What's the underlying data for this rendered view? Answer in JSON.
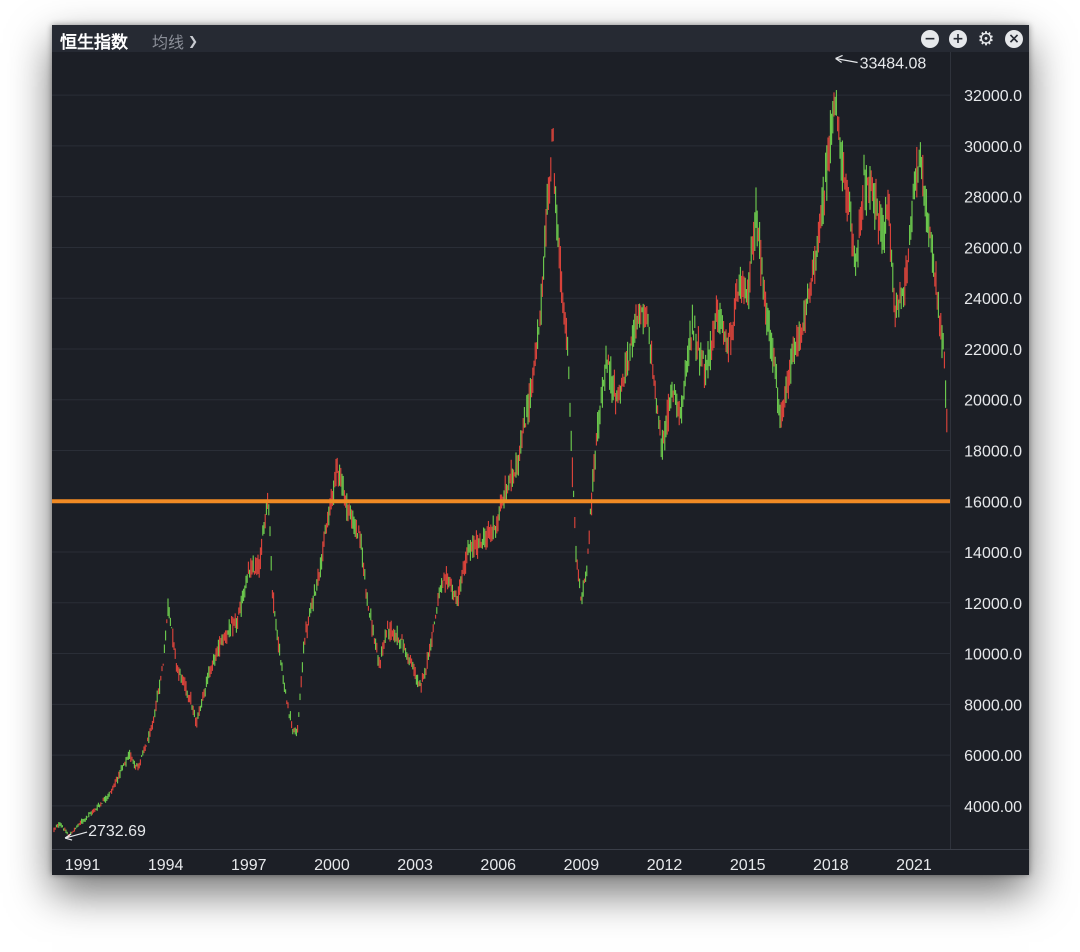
{
  "header": {
    "title": "恒生指数",
    "ma_label": "均线",
    "chevron_icon": "chevron-down-icon",
    "controls": [
      "minus-circle-icon",
      "plus-circle-icon",
      "gear-icon",
      "close-circle-icon"
    ]
  },
  "colors": {
    "background": "#1c1f26",
    "header": "#262a33",
    "up": "#6fd04f",
    "down": "#e2453c",
    "level_line": "#f08a24",
    "axis_text": "#e6e8eb"
  },
  "chart_data": {
    "type": "candlestick",
    "x_ticks": [
      "1991",
      "1994",
      "1997",
      "2000",
      "2003",
      "2006",
      "2009",
      "2012",
      "2015",
      "2018",
      "2021"
    ],
    "y_ticks": [
      "4000.00",
      "6000.00",
      "8000.00",
      "10000.0",
      "12000.0",
      "14000.0",
      "16000.0",
      "18000.0",
      "20000.0",
      "22000.0",
      "24000.0",
      "26000.0",
      "28000.0",
      "30000.0",
      "32000.0"
    ],
    "ylim": [
      2300,
      33700
    ],
    "xlim": [
      1989.9,
      2022.3
    ],
    "horizontal_line": 16000,
    "max_annotation": {
      "label": "33484.08",
      "x": 2018.1,
      "y": 33484.08
    },
    "min_annotation": {
      "label": "2732.69",
      "x": 1990.3,
      "y": 2732.69
    },
    "series_anchors": [
      [
        1989.9,
        3000
      ],
      [
        1990.2,
        3300
      ],
      [
        1990.5,
        2800
      ],
      [
        1990.9,
        3300
      ],
      [
        1991.5,
        3900
      ],
      [
        1992.0,
        4500
      ],
      [
        1992.4,
        5400
      ],
      [
        1992.7,
        6000
      ],
      [
        1993.0,
        5500
      ],
      [
        1993.5,
        7000
      ],
      [
        1993.9,
        9500
      ],
      [
        1994.1,
        12000
      ],
      [
        1994.4,
        9500
      ],
      [
        1994.9,
        8200
      ],
      [
        1995.1,
        7200
      ],
      [
        1995.5,
        9000
      ],
      [
        1996.0,
        10500
      ],
      [
        1996.6,
        11300
      ],
      [
        1997.0,
        13200
      ],
      [
        1997.4,
        13500
      ],
      [
        1997.6,
        15500
      ],
      [
        1997.7,
        16400
      ],
      [
        1997.85,
        12500
      ],
      [
        1998.0,
        11000
      ],
      [
        1998.3,
        8500
      ],
      [
        1998.6,
        7000
      ],
      [
        1998.75,
        6800
      ],
      [
        1999.0,
        10500
      ],
      [
        1999.5,
        13000
      ],
      [
        1999.9,
        15500
      ],
      [
        2000.2,
        17500
      ],
      [
        2000.5,
        16000
      ],
      [
        2000.8,
        15000
      ],
      [
        2001.0,
        14700
      ],
      [
        2001.3,
        12000
      ],
      [
        2001.7,
        9500
      ],
      [
        2002.0,
        11000
      ],
      [
        2002.5,
        10500
      ],
      [
        2002.9,
        9500
      ],
      [
        2003.2,
        8600
      ],
      [
        2003.5,
        10000
      ],
      [
        2003.9,
        12500
      ],
      [
        2004.2,
        13000
      ],
      [
        2004.5,
        12000
      ],
      [
        2004.9,
        14000
      ],
      [
        2005.5,
        14500
      ],
      [
        2005.9,
        15000
      ],
      [
        2006.3,
        16500
      ],
      [
        2006.7,
        17500
      ],
      [
        2007.2,
        20500
      ],
      [
        2007.5,
        23000
      ],
      [
        2007.8,
        28000
      ],
      [
        2007.95,
        30500
      ],
      [
        2008.2,
        25500
      ],
      [
        2008.5,
        22000
      ],
      [
        2008.8,
        14000
      ],
      [
        2009.0,
        12000
      ],
      [
        2009.2,
        13500
      ],
      [
        2009.5,
        18000
      ],
      [
        2009.9,
        21500
      ],
      [
        2010.3,
        20000
      ],
      [
        2010.7,
        21500
      ],
      [
        2011.0,
        23500
      ],
      [
        2011.4,
        23000
      ],
      [
        2011.7,
        20000
      ],
      [
        2011.9,
        18000
      ],
      [
        2012.3,
        20500
      ],
      [
        2012.6,
        19500
      ],
      [
        2013.0,
        23000
      ],
      [
        2013.5,
        21000
      ],
      [
        2013.9,
        23500
      ],
      [
        2014.3,
        22000
      ],
      [
        2014.7,
        24500
      ],
      [
        2015.0,
        24000
      ],
      [
        2015.3,
        27500
      ],
      [
        2015.6,
        24000
      ],
      [
        2015.9,
        22000
      ],
      [
        2016.2,
        19000
      ],
      [
        2016.6,
        21500
      ],
      [
        2016.9,
        22500
      ],
      [
        2017.3,
        24500
      ],
      [
        2017.7,
        27500
      ],
      [
        2018.0,
        30500
      ],
      [
        2018.1,
        32000
      ],
      [
        2018.5,
        28500
      ],
      [
        2018.9,
        25500
      ],
      [
        2019.2,
        28500
      ],
      [
        2019.5,
        28000
      ],
      [
        2019.9,
        26500
      ],
      [
        2020.1,
        27500
      ],
      [
        2020.3,
        23500
      ],
      [
        2020.7,
        24500
      ],
      [
        2021.0,
        28500
      ],
      [
        2021.2,
        29500
      ],
      [
        2021.5,
        27000
      ],
      [
        2021.9,
        23500
      ],
      [
        2022.1,
        21500
      ],
      [
        2022.2,
        18500
      ],
      [
        2022.3,
        16700
      ]
    ]
  }
}
